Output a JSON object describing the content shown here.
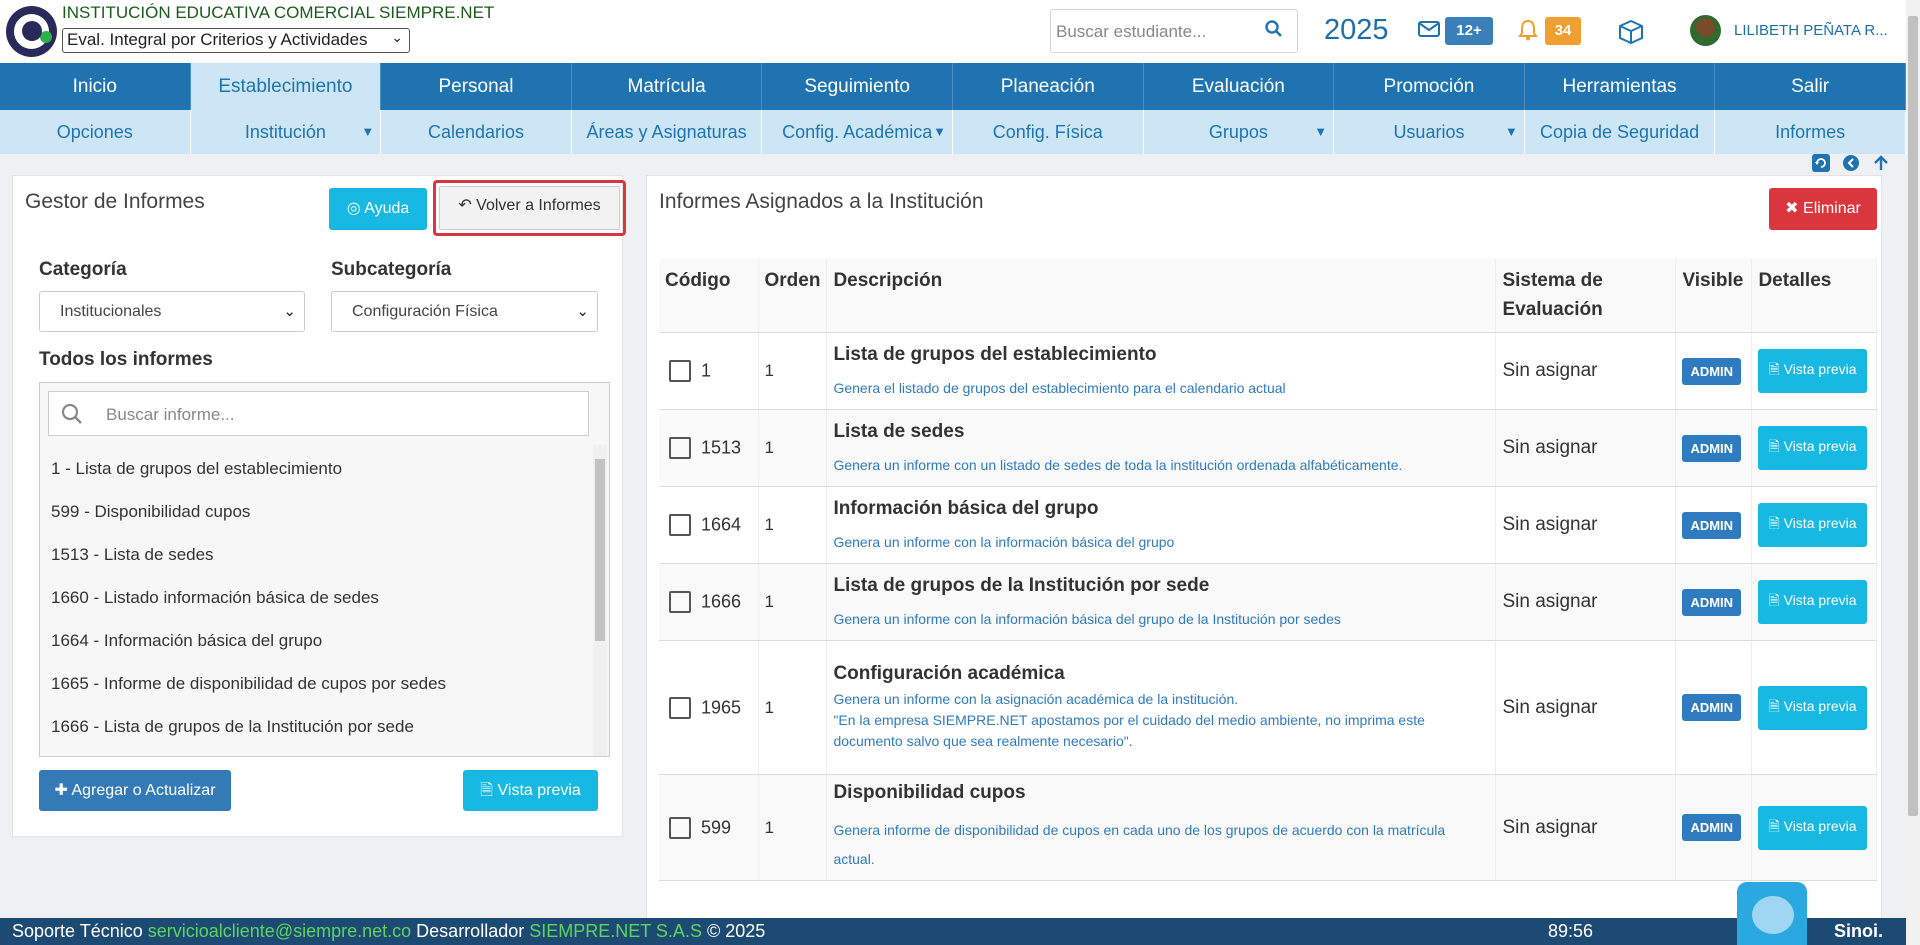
{
  "header": {
    "institution": "INSTITUCIÓN EDUCATIVA COMERCIAL SIEMPRE.NET",
    "evaluation_select": "Eval. Integral por Criterios y Actividades",
    "search_placeholder": "Buscar estudiante...",
    "year": "2025",
    "mail_badge": "12+",
    "bell_badge": "34",
    "username": "LILIBETH PEÑATA R...",
    "icons": [
      "envelope-icon",
      "bell-icon",
      "cube-icon",
      "search-icon"
    ]
  },
  "nav": {
    "main": [
      "Inicio",
      "Establecimiento",
      "Personal",
      "Matrícula",
      "Seguimiento",
      "Planeación",
      "Evaluación",
      "Promoción",
      "Herramientas",
      "Salir"
    ],
    "active_main": "Establecimiento",
    "sub": [
      "Opciones",
      "Institución",
      "Calendarios",
      "Áreas y Asignaturas",
      "Config. Académica",
      "Config. Física",
      "Grupos",
      "Usuarios",
      "Copia de Seguridad",
      "Informes"
    ]
  },
  "left": {
    "title": "Gestor de Informes",
    "help_label": "Ayuda",
    "back_label": "Volver a Informes",
    "category_label": "Categoría",
    "category_value": "Institucionales",
    "subcategory_label": "Subcategoría",
    "subcategory_value": "Configuración Física",
    "all_reports_label": "Todos los informes",
    "search_placeholder": "Buscar informe...",
    "items": [
      "1 - Lista de grupos del establecimiento",
      "599 - Disponibilidad cupos",
      "1513 - Lista de sedes",
      "1660 - Listado información básica de sedes",
      "1664 - Información básica del grupo",
      "1665 - Informe de disponibilidad de cupos por sedes",
      "1666 - Lista de grupos de la Institución por sede"
    ],
    "add_label": "Agregar o Actualizar",
    "preview_label": "Vista previa"
  },
  "right": {
    "title": "Informes Asignados a la Institución",
    "delete_label": "Eliminar",
    "columns": [
      "Código",
      "Orden",
      "Descripción",
      "Sistema de Evaluación",
      "Visible",
      "Detalles"
    ],
    "rows": [
      {
        "code": "1",
        "order": "1",
        "title": "Lista de grupos del establecimiento",
        "desc": "Genera el listado de grupos del establecimiento para el calendario actual",
        "desc2": "",
        "system": "Sin asignar",
        "visible": "ADMIN",
        "details": "Vista previa"
      },
      {
        "code": "1513",
        "order": "1",
        "title": "Lista de sedes",
        "desc": "Genera un informe con un listado de sedes de toda la institución ordenada alfabéticamente.",
        "desc2": "",
        "system": "Sin asignar",
        "visible": "ADMIN",
        "details": "Vista previa"
      },
      {
        "code": "1664",
        "order": "1",
        "title": "Información básica del grupo",
        "desc": "Genera un informe con la información básica del grupo",
        "desc2": "",
        "system": "Sin asignar",
        "visible": "ADMIN",
        "details": "Vista previa"
      },
      {
        "code": "1666",
        "order": "1",
        "title": "Lista de grupos de la Institución por sede",
        "desc": "Genera un informe con la información básica del grupo de la Institución por sedes",
        "desc2": "",
        "system": "Sin asignar",
        "visible": "ADMIN",
        "details": "Vista previa"
      },
      {
        "code": "1965",
        "order": "1",
        "title": "Configuración académica",
        "desc": "Genera un informe con la asignación académica de la institución.",
        "desc2": "\"En la empresa SIEMPRE.NET apostamos por el cuidado del medio ambiente, no imprima este documento salvo que sea realmente necesario\".",
        "system": "Sin asignar",
        "visible": "ADMIN",
        "details": "Vista previa"
      },
      {
        "code": "599",
        "order": "1",
        "title": "Disponibilidad cupos",
        "desc": "Genera informe de disponibilidad de cupos en cada uno de los grupos de acuerdo con la matrícula actual.",
        "desc2": "",
        "system": "Sin asignar",
        "visible": "ADMIN",
        "details": "Vista previa"
      }
    ]
  },
  "footer": {
    "support_label": "Soporte Técnico",
    "support_email": "servicioalcliente@siempre.net.co",
    "dev_label": "Desarrollador",
    "dev_name": "SIEMPRE.NET S.A.S",
    "copyright": "© 2025",
    "timer": "89:56",
    "brand": "Sinoi."
  }
}
